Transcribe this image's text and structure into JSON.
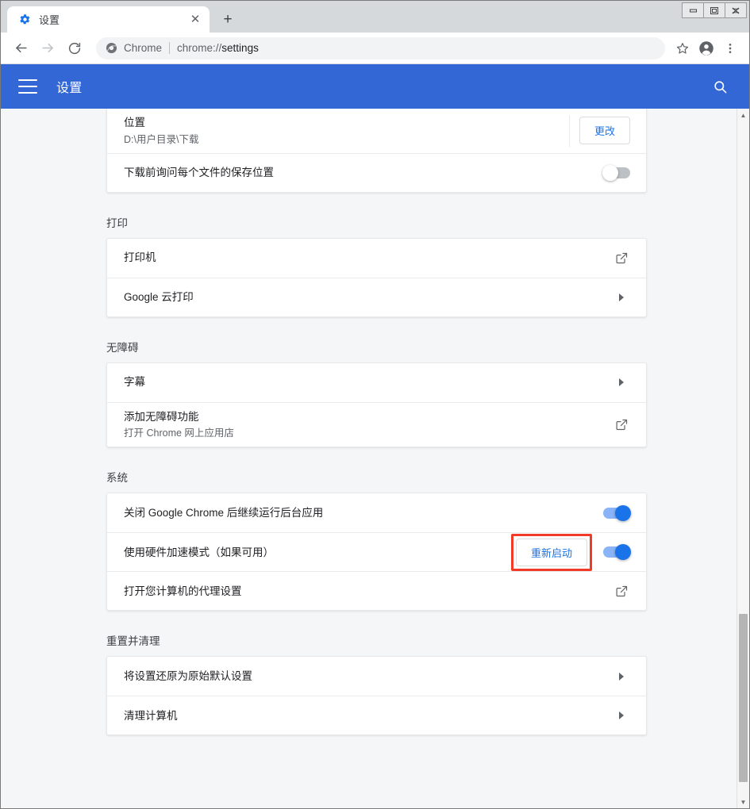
{
  "window": {
    "controls": [
      {
        "name": "minimize",
        "glyph": "—"
      },
      {
        "name": "maximize",
        "glyph": "❐"
      },
      {
        "name": "close",
        "glyph": "✕"
      }
    ]
  },
  "tab": {
    "title": "设置",
    "favicon": "gear-icon",
    "close_glyph": "✕",
    "new_tab_glyph": "+"
  },
  "toolbar": {
    "back_glyph": "←",
    "forward_glyph": "→",
    "reload_glyph": "⟳",
    "omnibox": {
      "chrome_label": "Chrome",
      "url_scheme": "chrome://",
      "url_path": "settings"
    },
    "bookmark_icon": "star-icon",
    "profile_icon": "account-icon",
    "menu_icon": "kebab-menu-icon"
  },
  "settings_header": {
    "menu_icon": "hamburger-icon",
    "title": "设置",
    "search_icon": "search-icon",
    "bg_color": "#3367d6"
  },
  "sections": [
    {
      "id": "downloads",
      "title": "",
      "clipped_top": true,
      "rows": [
        {
          "id": "download-location",
          "label": "位置",
          "sublabel": "D:\\用户目录\\下载",
          "control": "button",
          "button_label": "更改"
        },
        {
          "id": "ask-where-to-save",
          "label": "下载前询问每个文件的保存位置",
          "sublabel": "",
          "control": "toggle",
          "toggle_state": "off"
        }
      ]
    },
    {
      "id": "printing",
      "title": "打印",
      "clipped_top": false,
      "rows": [
        {
          "id": "printers",
          "label": "打印机",
          "sublabel": "",
          "control": "external-link-icon"
        },
        {
          "id": "google-cloud-print",
          "label": "Google 云打印",
          "sublabel": "",
          "control": "chevron-right-icon"
        }
      ]
    },
    {
      "id": "accessibility",
      "title": "无障碍",
      "clipped_top": false,
      "rows": [
        {
          "id": "captions",
          "label": "字幕",
          "sublabel": "",
          "control": "chevron-right-icon"
        },
        {
          "id": "add-accessibility-features",
          "label": "添加无障碍功能",
          "sublabel": "打开 Chrome 网上应用店",
          "control": "external-link-icon"
        }
      ]
    },
    {
      "id": "system",
      "title": "系统",
      "clipped_top": false,
      "rows": [
        {
          "id": "background-apps",
          "label": "关闭 Google Chrome 后继续运行后台应用",
          "sublabel": "",
          "control": "toggle",
          "toggle_state": "on"
        },
        {
          "id": "hardware-acceleration",
          "label": "使用硬件加速模式（如果可用）",
          "sublabel": "",
          "control": "relaunch-toggle",
          "button_label": "重新启动",
          "toggle_state": "on",
          "highlighted": true,
          "highlight_color": "#f23a28"
        },
        {
          "id": "proxy-settings",
          "label": "打开您计算机的代理设置",
          "sublabel": "",
          "control": "external-link-icon"
        }
      ]
    },
    {
      "id": "reset-cleanup",
      "title": "重置并清理",
      "clipped_top": false,
      "rows": [
        {
          "id": "restore-defaults",
          "label": "将设置还原为原始默认设置",
          "sublabel": "",
          "control": "chevron-right-icon"
        },
        {
          "id": "clean-up-computer",
          "label": "清理计算机",
          "sublabel": "",
          "control": "chevron-right-icon"
        }
      ]
    }
  ],
  "scrollbar": {
    "up_glyph": "▲",
    "down_glyph": "▼"
  },
  "colors": {
    "accent": "#1a73e8",
    "header_blue": "#3367d6",
    "toggle_on": "#1a73e8",
    "toggle_off": "#bdc1c6",
    "highlight_red": "#f23a28",
    "page_bg": "#f5f6f7"
  }
}
